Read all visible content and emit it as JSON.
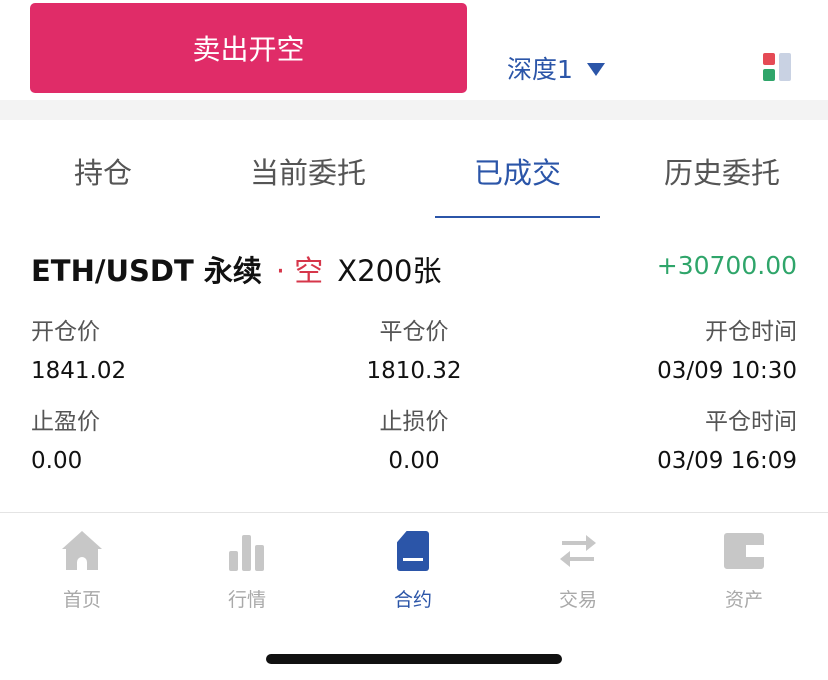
{
  "topbar": {
    "sell_label": "卖出开空",
    "depth_label": "深度1"
  },
  "tabs": [
    {
      "label": "持仓",
      "active": false
    },
    {
      "label": "当前委托",
      "active": false
    },
    {
      "label": "已成交",
      "active": true
    },
    {
      "label": "历史委托",
      "active": false
    }
  ],
  "record": {
    "pair": "ETH/USDT 永续",
    "side": "· 空",
    "leverage": "X200张",
    "pnl": "+30700.00",
    "open_price_label": "开仓价",
    "open_price": "1841.02",
    "close_price_label": "平仓价",
    "close_price": "1810.32",
    "open_time_label": "开仓时间",
    "open_time": "03/09 10:30",
    "take_profit_label": "止盈价",
    "take_profit": "0.00",
    "stop_loss_label": "止损价",
    "stop_loss": "0.00",
    "close_time_label": "平仓时间",
    "close_time": "03/09 16:09"
  },
  "nav": [
    {
      "label": "首页",
      "icon": "home-icon",
      "active": false
    },
    {
      "label": "行情",
      "icon": "chart-icon",
      "active": false
    },
    {
      "label": "合约",
      "icon": "contract-icon",
      "active": true
    },
    {
      "label": "交易",
      "icon": "swap-icon",
      "active": false
    },
    {
      "label": "资产",
      "icon": "wallet-icon",
      "active": false
    }
  ],
  "colors": {
    "accent": "#2b55a8",
    "sell": "#e02c68",
    "profit": "#2fa56a",
    "short": "#d6364a"
  }
}
